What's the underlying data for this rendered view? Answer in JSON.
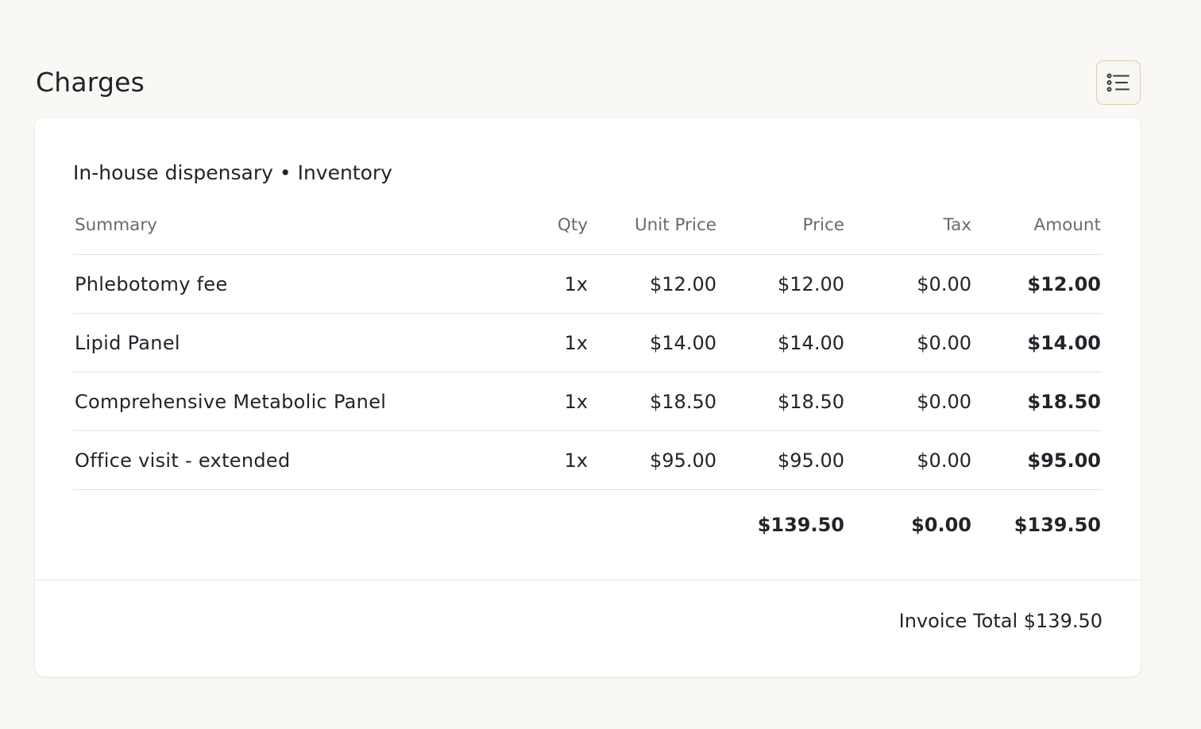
{
  "header": {
    "title": "Charges",
    "filter_icon": "list-filter-icon"
  },
  "section": {
    "title": "In-house dispensary • Inventory"
  },
  "table": {
    "columns": {
      "summary": "Summary",
      "qty": "Qty",
      "unit_price": "Unit Price",
      "price": "Price",
      "tax": "Tax",
      "amount": "Amount"
    },
    "rows": [
      {
        "summary": "Phlebotomy fee",
        "qty": "1x",
        "unit_price": "$12.00",
        "price": "$12.00",
        "tax": "$0.00",
        "amount": "$12.00"
      },
      {
        "summary": "Lipid Panel",
        "qty": "1x",
        "unit_price": "$14.00",
        "price": "$14.00",
        "tax": "$0.00",
        "amount": "$14.00"
      },
      {
        "summary": "Comprehensive Metabolic Panel",
        "qty": "1x",
        "unit_price": "$18.50",
        "price": "$18.50",
        "tax": "$0.00",
        "amount": "$18.50"
      },
      {
        "summary": "Office visit - extended",
        "qty": "1x",
        "unit_price": "$95.00",
        "price": "$95.00",
        "tax": "$0.00",
        "amount": "$95.00"
      }
    ],
    "totals": {
      "price": "$139.50",
      "tax": "$0.00",
      "amount": "$139.50"
    }
  },
  "footer": {
    "invoice_total": "Invoice Total $139.50"
  },
  "colors": {
    "background": "#f9f8f4",
    "card": "#ffffff",
    "text": "#24232b",
    "muted_text": "#6b6973",
    "divider": "#e8e2d6",
    "button_border": "#d9ccb4"
  }
}
